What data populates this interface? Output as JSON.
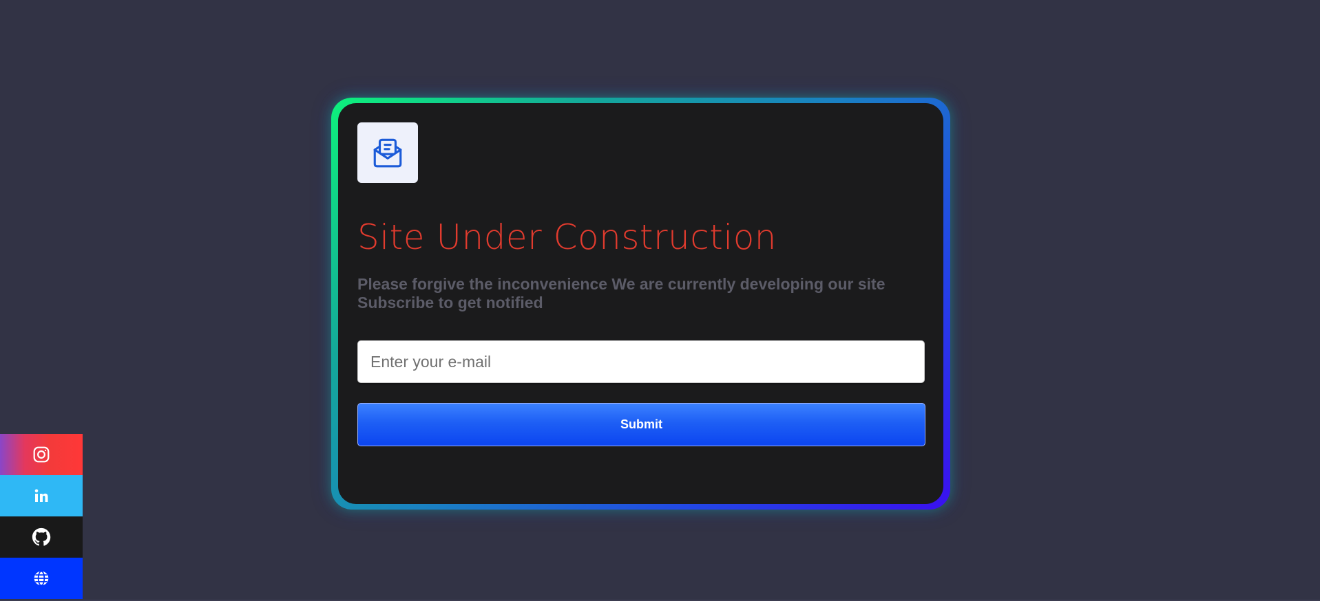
{
  "colors": {
    "background": "#323345",
    "card_background": "#1b1b1c",
    "title": "#e13b2e",
    "subtitle": "#5c5c68",
    "submit_button": "#1557f5",
    "frame_gradient_start": "#0ef27c",
    "frame_gradient_end": "#3a10f0"
  },
  "logo": {
    "icon": "envelope-open-letter-icon",
    "color": "#1b5bd8"
  },
  "heading": {
    "title": "Site Under Construction",
    "subtitle_line1": "Please forgive the inconvenience We are currently developing our site",
    "subtitle_line2": "Subscribe to get notified"
  },
  "form": {
    "email_placeholder": "Enter your e-mail",
    "email_value": "",
    "submit_label": "Submit"
  },
  "social": [
    {
      "name": "instagram",
      "icon": "instagram-icon",
      "color": "#f33a3a"
    },
    {
      "name": "linkedin",
      "icon": "linkedin-icon",
      "color": "#2fb8f5"
    },
    {
      "name": "github",
      "icon": "github-icon",
      "color": "#191919"
    },
    {
      "name": "website",
      "icon": "globe-icon",
      "color": "#0036ff"
    }
  ]
}
